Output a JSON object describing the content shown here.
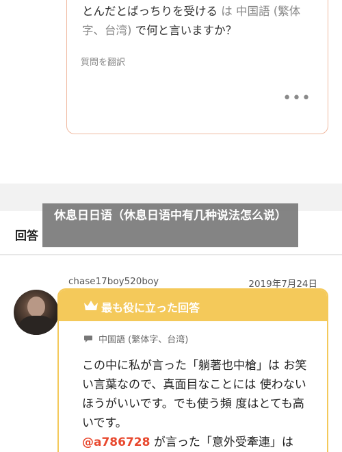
{
  "question": {
    "text_before": "とんだとばっちりを受ける",
    "connector": " は ",
    "language": "中国語 (繁体字、台湾)",
    "text_after": " で何と言いますか？",
    "translate_label": "質問を翻訳",
    "more_icon": "more-dots-icon"
  },
  "answers_header": {
    "title": "回答"
  },
  "answer": {
    "username": "chase17boy520boy",
    "date": "2019年7月24日",
    "best_label": "最も役に立った回答",
    "language_label": "中国語 (繁体字、台湾)",
    "body_1": "この中に私が言った「躺著也中槍」は お笑い言葉なので、真面目なことには 使わないほうがいいです。でも使う頻 度はとても高いです。",
    "mention": "@a786728",
    "body_2": " が言った「意外受牽連」は"
  },
  "overlay": {
    "title": "休息日日语（休息日语中有几种说法怎么说）"
  },
  "colors": {
    "accent_yellow": "#f4c95a",
    "question_border": "#f0b9a0",
    "mention_red": "#e8482e"
  }
}
